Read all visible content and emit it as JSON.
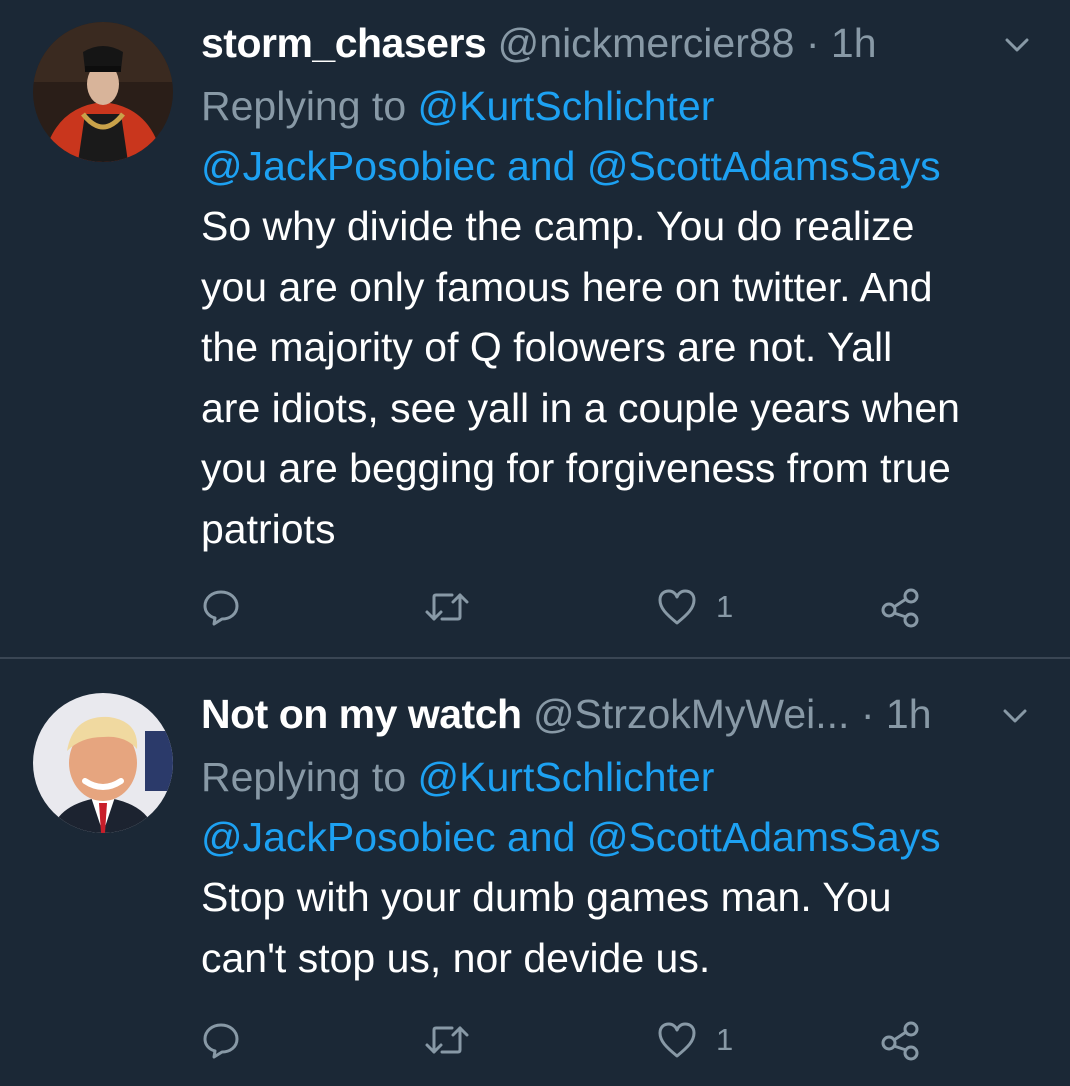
{
  "tweets": [
    {
      "name": "storm_chasers",
      "handle": "@nickmercier88",
      "separator": "·",
      "time": "1h",
      "replying_prefix": "Replying to",
      "mention_1": "@KurtSchlichter",
      "mention_2": "@JackPosobiec",
      "mention_joiner": "and",
      "mention_3": "@ScottAdamsSays",
      "lines": [
        "So why divide the camp. You do realize",
        "you are only famous here on twitter. And",
        "the majority of Q folowers are not. Yall",
        "are idiots, see yall in a couple years when",
        "you are begging for forgiveness from true",
        "patriots"
      ],
      "like_count": "1",
      "icons": [
        "chevron-down-icon",
        "reply-icon",
        "retweet-icon",
        "heart-icon",
        "share-icon"
      ]
    },
    {
      "name": "Not on my watch",
      "handle": "@StrzokMyWei...",
      "separator": "·",
      "time": "1h",
      "replying_prefix": "Replying to",
      "mention_1": "@KurtSchlichter",
      "mention_2": "@JackPosobiec",
      "mention_joiner": "and",
      "mention_3": "@ScottAdamsSays",
      "lines": [
        "Stop with your dumb games man. You",
        "can't stop us, nor devide us."
      ],
      "like_count": "1",
      "icons": [
        "chevron-down-icon",
        "reply-icon",
        "retweet-icon",
        "heart-icon",
        "share-icon"
      ]
    }
  ],
  "colors": {
    "background": "#1b2836",
    "text": "#ffffff",
    "muted": "#8899a6",
    "link": "#1da1f2",
    "divider": "#3a4654"
  }
}
